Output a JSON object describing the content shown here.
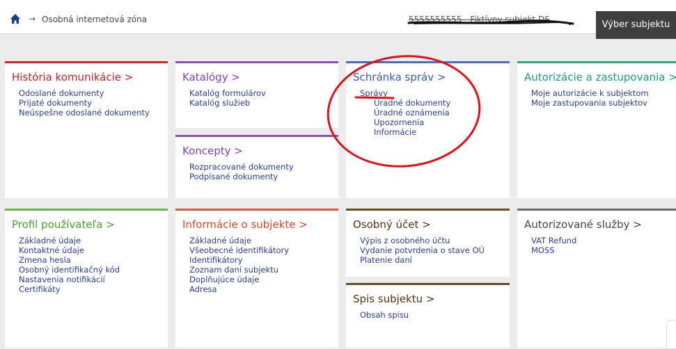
{
  "header": {
    "breadcrumb": "Osobná internetová zóna",
    "subject_text": "5555555555 - Fiktívny subjekt DS",
    "select_subject_button": "Výber subjektu"
  },
  "tiles": {
    "historia": {
      "title": "História komunikácie >",
      "links": [
        "Odoslané dokumenty",
        "Prijaté dokumenty",
        "Neúspešne odoslané dokumenty"
      ]
    },
    "katalogy": {
      "title": "Katalógy >",
      "links": [
        "Katalóg formulárov",
        "Katalóg služieb"
      ]
    },
    "koncepty": {
      "title": "Koncepty >",
      "links": [
        "Rozpracované dokumenty",
        "Podpísané dokumenty"
      ]
    },
    "schranka": {
      "title": "Schránka správ >",
      "link": "Správy",
      "sublinks": [
        "Úradné dokumenty",
        "Úradné oznámenia",
        "Upozornenia",
        "Informácie"
      ]
    },
    "autorizacie": {
      "title": "Autorizácie a zastupovania >",
      "links": [
        "Moje autorizácie k subjektom",
        "Moje zastupovania subjektov"
      ]
    },
    "profil": {
      "title": "Profil používateľa >",
      "links": [
        "Základné údaje",
        "Kontaktné údaje",
        "Zmena hesla",
        "Osobný identifikačný kód",
        "Nastavenia notifikácií",
        "Certifikáty"
      ]
    },
    "informacie": {
      "title": "Informácie o subjekte >",
      "links": [
        "Základné údaje",
        "Všeobecné identifikátory",
        "Identifikátory",
        "Zoznam daní subjektu",
        "Doplňujúce údaje",
        "Adresa"
      ]
    },
    "osobny_ucet": {
      "title": "Osobný účet >",
      "links": [
        "Výpis z osobného účtu",
        "Vydanie potvrdenia o stave OÚ",
        "Platenie daní"
      ]
    },
    "spis": {
      "title": "Spis subjektu >",
      "links": [
        "Obsah spisu"
      ]
    },
    "autorizovane": {
      "title": "Autorizované služby >",
      "links": [
        "VAT Refund",
        "MOSS"
      ]
    }
  },
  "colors": {
    "link": "#2b3f86",
    "annotation": "#e0101a",
    "header_button_bg": "#3f3f3f"
  }
}
